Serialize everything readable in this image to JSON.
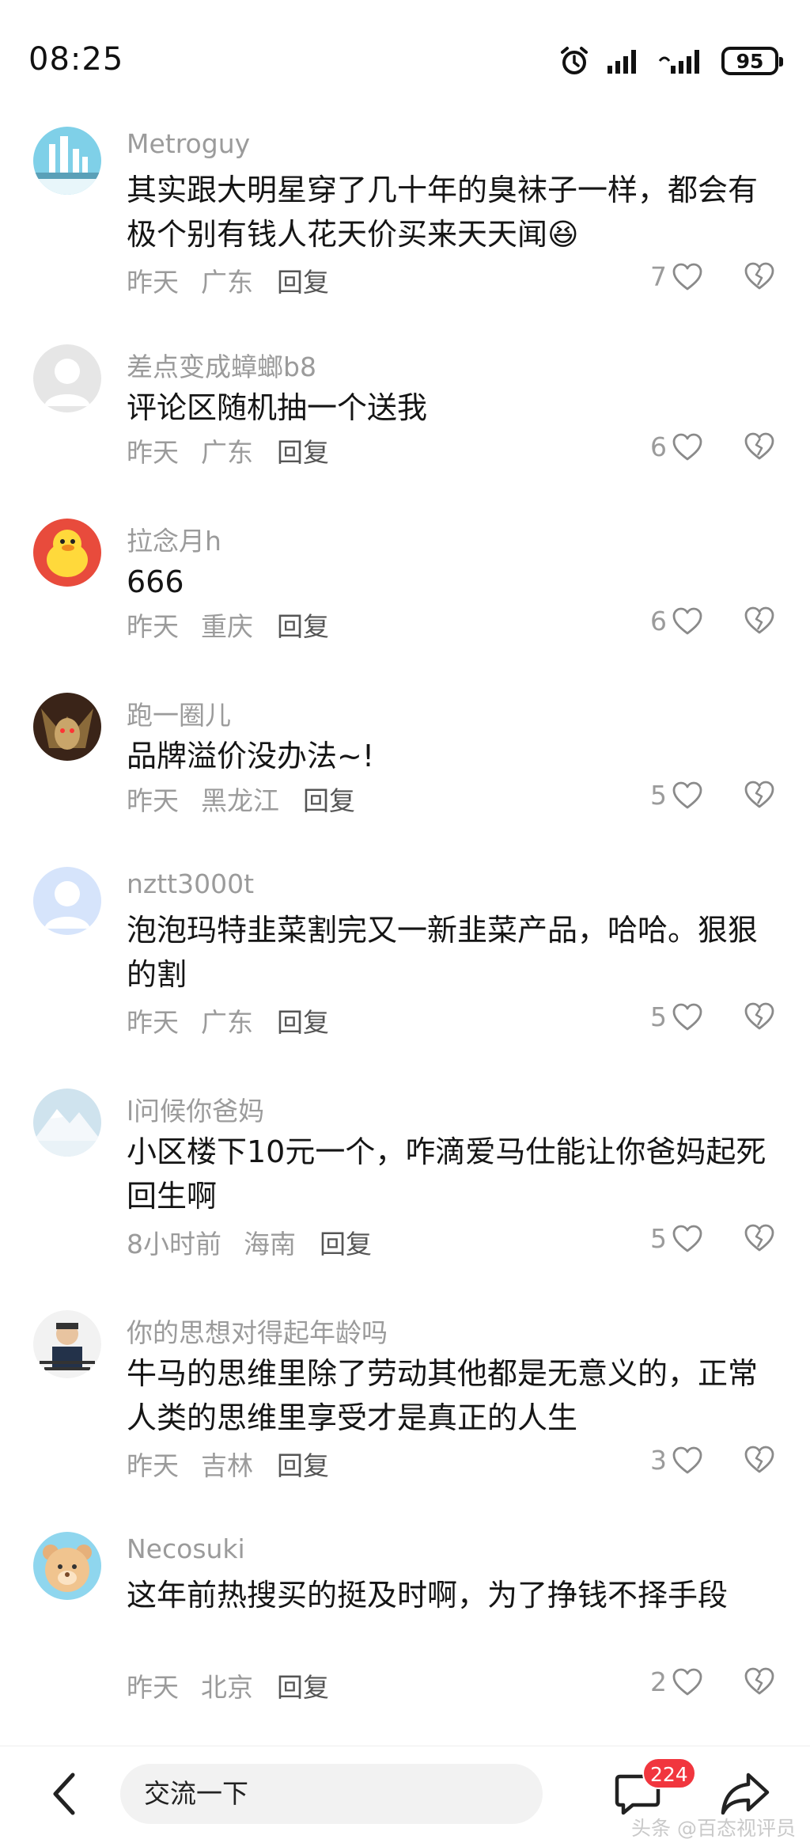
{
  "status_bar": {
    "time": "08:25",
    "battery": "95"
  },
  "comments": [
    {
      "user": "Metroguy",
      "text": "其实跟大明星穿了几十年的臭袜子一样，都会有极个别有钱人花天价买来天天闻😆",
      "time": "昨天",
      "location": "广东",
      "reply": "回复",
      "likes": "7"
    },
    {
      "user": "差点变成蟑螂b8",
      "text": "评论区随机抽一个送我",
      "time": "昨天",
      "location": "广东",
      "reply": "回复",
      "likes": "6"
    },
    {
      "user": "拉念月h",
      "text": "666",
      "time": "昨天",
      "location": "重庆",
      "reply": "回复",
      "likes": "6"
    },
    {
      "user": "跑一圈儿",
      "text": "品牌溢价没办法~!",
      "time": "昨天",
      "location": "黑龙江",
      "reply": "回复",
      "likes": "5"
    },
    {
      "user": "nztt3000t",
      "text": "泡泡玛特韭菜割完又一新韭菜产品，哈哈。狠狠的割",
      "time": "昨天",
      "location": "广东",
      "reply": "回复",
      "likes": "5"
    },
    {
      "user": "l问候你爸妈",
      "text": "小区楼下10元一个，咋滴爱马仕能让你爸妈起死回生啊",
      "time": "8小时前",
      "location": "海南",
      "reply": "回复",
      "likes": "5"
    },
    {
      "user": "你的思想对得起年龄吗",
      "text": "牛马的思维里除了劳动其他都是无意义的，正常人类的思维里享受才是真正的人生",
      "time": "昨天",
      "location": "吉林",
      "reply": "回复",
      "likes": "3"
    },
    {
      "user": "Necosuki",
      "text": "这年前热搜买的挺及时啊，为了挣钱不择手段",
      "time": "昨天",
      "location": "北京",
      "reply": "回复",
      "likes": "2"
    }
  ],
  "bottom_bar": {
    "input_placeholder": "交流一下",
    "message_count": "224",
    "watermark": "头条 @百态视评员"
  },
  "colors": {
    "badge": "#f1363e",
    "meta_text": "#9b9b9b",
    "input_bg": "#f2f2f2"
  },
  "icons": [
    "alarm-icon",
    "signal-icon",
    "battery-icon",
    "heart-icon",
    "dislike-heart-icon",
    "back-arrow-icon",
    "message-icon",
    "share-icon"
  ]
}
